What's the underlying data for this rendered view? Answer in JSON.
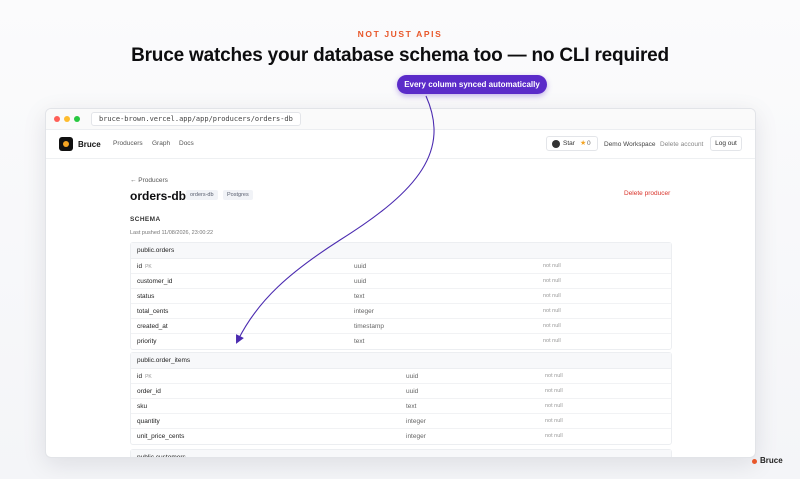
{
  "hero": {
    "eyebrow": "NOT JUST APIS",
    "headline": "Bruce watches your database schema too — no CLI required",
    "pill": "Every column synced automatically"
  },
  "browser": {
    "url": "bruce-brown.vercel.app/app/producers/orders-db"
  },
  "nav": {
    "brand": "Bruce",
    "links": [
      "Producers",
      "Graph",
      "Docs"
    ],
    "star_label": "Star",
    "star_count": "0",
    "workspace": "Demo Workspace",
    "delete_account": "Delete account",
    "logout": "Log out"
  },
  "page": {
    "back": "← Producers",
    "title": "orders-db",
    "tags": [
      "orders-db",
      "Postgres"
    ],
    "delete_producer": "Delete producer",
    "schema_label": "SCHEMA",
    "last_pushed": "Last pushed 11/08/2026, 23:00:22"
  },
  "tables": [
    {
      "name": "public.orders",
      "columns": [
        {
          "name": "id",
          "pk": "PK",
          "type": "uuid",
          "nullable": "not null"
        },
        {
          "name": "customer_id",
          "pk": "",
          "type": "uuid",
          "nullable": "not null"
        },
        {
          "name": "status",
          "pk": "",
          "type": "text",
          "nullable": "not null"
        },
        {
          "name": "total_cents",
          "pk": "",
          "type": "integer",
          "nullable": "not null"
        },
        {
          "name": "created_at",
          "pk": "",
          "type": "timestamp",
          "nullable": "not null"
        },
        {
          "name": "priority",
          "pk": "",
          "type": "text",
          "nullable": "not null"
        }
      ]
    },
    {
      "name": "public.order_items",
      "columns": [
        {
          "name": "id",
          "pk": "PK",
          "type": "uuid",
          "nullable": "not null"
        },
        {
          "name": "order_id",
          "pk": "",
          "type": "uuid",
          "nullable": "not null"
        },
        {
          "name": "sku",
          "pk": "",
          "type": "text",
          "nullable": "not null"
        },
        {
          "name": "quantity",
          "pk": "",
          "type": "integer",
          "nullable": "not null"
        },
        {
          "name": "unit_price_cents",
          "pk": "",
          "type": "integer",
          "nullable": "not null"
        }
      ]
    },
    {
      "name": "public.customers",
      "columns": []
    }
  ],
  "footer": {
    "brand": "Bruce"
  },
  "colors": {
    "accent": "#e8572a",
    "pill": "#5b2bc9",
    "danger": "#d9342b"
  }
}
